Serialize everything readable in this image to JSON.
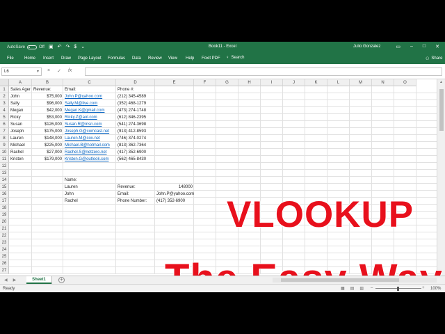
{
  "titlebar": {
    "autosave_label": "AutoSave",
    "autosave_state": "Off",
    "document_title": "Book11 - Excel",
    "user": "Julio Gonzalez"
  },
  "ribbon": {
    "tabs": [
      "File",
      "Home",
      "Insert",
      "Draw",
      "Page Layout",
      "Formulas",
      "Data",
      "Review",
      "View",
      "Help",
      "Foxit PDF"
    ],
    "search_label": "Search",
    "share_label": "Share"
  },
  "formula_bar": {
    "name_box": "L6",
    "cancel": "×",
    "enter": "✓",
    "fx": "fx",
    "content": ""
  },
  "grid": {
    "columns": [
      "A",
      "B",
      "C",
      "D",
      "E",
      "F",
      "G",
      "H",
      "I",
      "J",
      "K",
      "L",
      "M",
      "N",
      "O"
    ],
    "rows": [
      "1",
      "2",
      "3",
      "4",
      "5",
      "6",
      "7",
      "8",
      "9",
      "10",
      "11",
      "12",
      "13",
      "14",
      "15",
      "16",
      "17",
      "18",
      "19",
      "20",
      "21",
      "22",
      "23",
      "24",
      "25",
      "26",
      "27"
    ],
    "headers": {
      "A1": "Sales Agents",
      "B1": "Revenue:",
      "C1": "Email:",
      "D1": "Phone #:"
    },
    "agents": [
      {
        "name": "John",
        "revenue": "$75,000",
        "email": "John.P@yahoo.com",
        "phone": "(212) 345-4589"
      },
      {
        "name": "Sally",
        "revenue": "$96,000",
        "email": "Sally.M@live.com",
        "phone": "(352) 468-1279"
      },
      {
        "name": "Megan",
        "revenue": "$42,000",
        "email": "Megan.K@gmail.com",
        "phone": "(473) 274-1748"
      },
      {
        "name": "Ricky",
        "revenue": "$53,000",
        "email": "Ricky.Z@aol.com",
        "phone": "(612) 846-2395"
      },
      {
        "name": "Susan",
        "revenue": "$126,000",
        "email": "Susan.R@msn.com",
        "phone": "(541) 274-3698"
      },
      {
        "name": "Joseph",
        "revenue": "$175,000",
        "email": "Joseph.G@comcast.net",
        "phone": "(913) 412-8593"
      },
      {
        "name": "Lauren",
        "revenue": "$148,000",
        "email": "Lauren.M@cox.net",
        "phone": "(746) 374-0274"
      },
      {
        "name": "Michael",
        "revenue": "$225,000",
        "email": "Michael.B@hotmail.com",
        "phone": "(813) 362-7364"
      },
      {
        "name": "Rachel",
        "revenue": "$27,000",
        "email": "Rachel.S@netzero.net",
        "phone": "(417) 352-6900"
      },
      {
        "name": "Kristen",
        "revenue": "$179,000",
        "email": "Kristen.G@outlook.com",
        "phone": "(562) 465-8430"
      }
    ],
    "lookup": {
      "C14": "Name:",
      "C15": "Lauren",
      "D15": "Revenue:",
      "E15": "148000",
      "C16": "John",
      "D16": "Email:",
      "E16": "John.P@yahoo.com",
      "C17": "Rachel",
      "D17": "Phone Number:",
      "E17": "(417) 352-6900"
    }
  },
  "overlay": {
    "line1": "VLOOKUP",
    "line2": "The Easy Way!"
  },
  "sheets": {
    "active": "Sheet1",
    "add": "+"
  },
  "status": {
    "ready": "Ready",
    "zoom": "100%",
    "zoom_level": 1.0
  },
  "colors": {
    "excel_green": "#217346",
    "overlay_red": "#e8101c",
    "hyperlink": "#0563c1"
  }
}
